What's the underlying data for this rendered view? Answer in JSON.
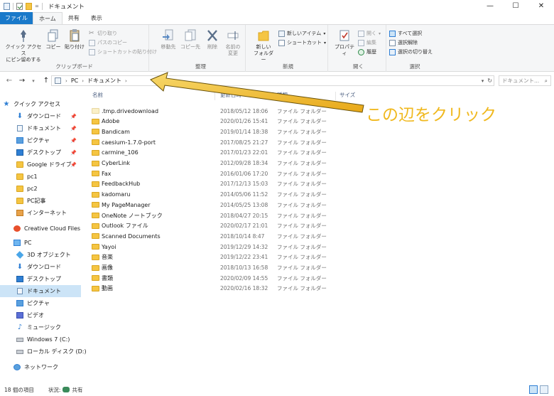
{
  "titlebar": {
    "title": "ドキュメント",
    "qat_dropdown": "=",
    "controls": {
      "minimize": "—",
      "maximize": "☐",
      "close": "✕"
    }
  },
  "ribbon_tabs": [
    "ファイル",
    "ホーム",
    "共有",
    "表示"
  ],
  "ribbon": {
    "clipboard": {
      "label": "クリップボード",
      "pin_quick_access_1": "クイック アクセス",
      "pin_quick_access_2": "にピン留めする",
      "copy": "コピー",
      "paste": "貼り付け",
      "cut": "切り取り",
      "copy_path": "パスのコピー",
      "paste_shortcut": "ショートカットの貼り付け"
    },
    "organize": {
      "label": "整理",
      "move_to": "移動先",
      "copy_to": "コピー先",
      "delete": "削除",
      "rename_1": "名前の",
      "rename_2": "変更"
    },
    "new": {
      "label": "新規",
      "new_folder_1": "新しい",
      "new_folder_2": "フォルダー",
      "new_item": "新しいアイテム",
      "shortcut": "ショートカット"
    },
    "open": {
      "label": "開く",
      "properties": "プロパティ",
      "open": "開く",
      "edit": "編集",
      "history": "履歴"
    },
    "select": {
      "label": "選択",
      "select_all": "すべて選択",
      "select_none": "選択解除",
      "invert": "選択の切り替え"
    }
  },
  "address": {
    "breadcrumb": [
      "PC",
      "ドキュメント"
    ],
    "search_placeholder": "ドキュメント..."
  },
  "nav": {
    "quick_access": "クイック アクセス",
    "items": [
      {
        "label": "ダウンロード",
        "icon": "download-icon",
        "pinned": true
      },
      {
        "label": "ドキュメント",
        "icon": "document-icon",
        "pinned": true
      },
      {
        "label": "ピクチャ",
        "icon": "pictures-icon",
        "pinned": true
      },
      {
        "label": "デスクトップ",
        "icon": "desktop-icon",
        "pinned": true
      },
      {
        "label": "Google ドライブ",
        "icon": "folder-icon",
        "pinned": true
      },
      {
        "label": "pc1",
        "icon": "folder-icon",
        "pinned": false
      },
      {
        "label": "pc2",
        "icon": "folder-icon",
        "pinned": false
      },
      {
        "label": "PC記事",
        "icon": "folder-icon",
        "pinned": false
      },
      {
        "label": "インターネット",
        "icon": "folder-icon",
        "pinned": false
      }
    ],
    "creative_cloud": "Creative Cloud Files",
    "pc": "PC",
    "pc_items": [
      {
        "label": "3D オブジェクト",
        "icon": "3d-objects-icon"
      },
      {
        "label": "ダウンロード",
        "icon": "download-icon"
      },
      {
        "label": "デスクトップ",
        "icon": "desktop-icon"
      },
      {
        "label": "ドキュメント",
        "icon": "document-icon"
      },
      {
        "label": "ピクチャ",
        "icon": "pictures-icon"
      },
      {
        "label": "ビデオ",
        "icon": "video-icon"
      },
      {
        "label": "ミュージック",
        "icon": "music-icon"
      },
      {
        "label": "Windows 7 (C:)",
        "icon": "drive-icon"
      },
      {
        "label": "ローカル ディスク (D:)",
        "icon": "drive-icon"
      }
    ],
    "network": "ネットワーク"
  },
  "columns": {
    "name": "名前",
    "date": "更新日時",
    "type": "種類",
    "size": "サイズ"
  },
  "files": [
    {
      "name": ".tmp.drivedownload",
      "date": "2018/05/12 18:06",
      "type": "ファイル フォルダー"
    },
    {
      "name": "Adobe",
      "date": "2020/01/26 15:41",
      "type": "ファイル フォルダー"
    },
    {
      "name": "Bandicam",
      "date": "2019/01/14 18:38",
      "type": "ファイル フォルダー"
    },
    {
      "name": "caesium-1.7.0-port",
      "date": "2017/08/25 21:27",
      "type": "ファイル フォルダー"
    },
    {
      "name": "carmine_106",
      "date": "2017/01/23 22:01",
      "type": "ファイル フォルダー"
    },
    {
      "name": "CyberLink",
      "date": "2012/09/28 18:34",
      "type": "ファイル フォルダー"
    },
    {
      "name": "Fax",
      "date": "2016/01/06 17:20",
      "type": "ファイル フォルダー"
    },
    {
      "name": "FeedbackHub",
      "date": "2017/12/13 15:03",
      "type": "ファイル フォルダー"
    },
    {
      "name": "kadomaru",
      "date": "2014/05/06 11:52",
      "type": "ファイル フォルダー"
    },
    {
      "name": "My PageManager",
      "date": "2014/05/25 13:08",
      "type": "ファイル フォルダー"
    },
    {
      "name": "OneNote ノートブック",
      "date": "2018/04/27 20:15",
      "type": "ファイル フォルダー"
    },
    {
      "name": "Outlook ファイル",
      "date": "2020/02/17 21:01",
      "type": "ファイル フォルダー"
    },
    {
      "name": "Scanned Documents",
      "date": "2018/10/14 8:47",
      "type": "ファイル フォルダー"
    },
    {
      "name": "Yayoi",
      "date": "2019/12/29 14:32",
      "type": "ファイル フォルダー"
    },
    {
      "name": "音楽",
      "date": "2019/12/22 23:41",
      "type": "ファイル フォルダー"
    },
    {
      "name": "画像",
      "date": "2018/10/13 16:58",
      "type": "ファイル フォルダー"
    },
    {
      "name": "書類",
      "date": "2020/02/09 14:55",
      "type": "ファイル フォルダー"
    },
    {
      "name": "動画",
      "date": "2020/02/16 18:32",
      "type": "ファイル フォルダー"
    }
  ],
  "status": {
    "count": "18 個の項目",
    "state_label": "状況:",
    "state_value": "共有"
  },
  "annotation": {
    "text": "この辺をクリック",
    "color": "#f0b81e"
  }
}
